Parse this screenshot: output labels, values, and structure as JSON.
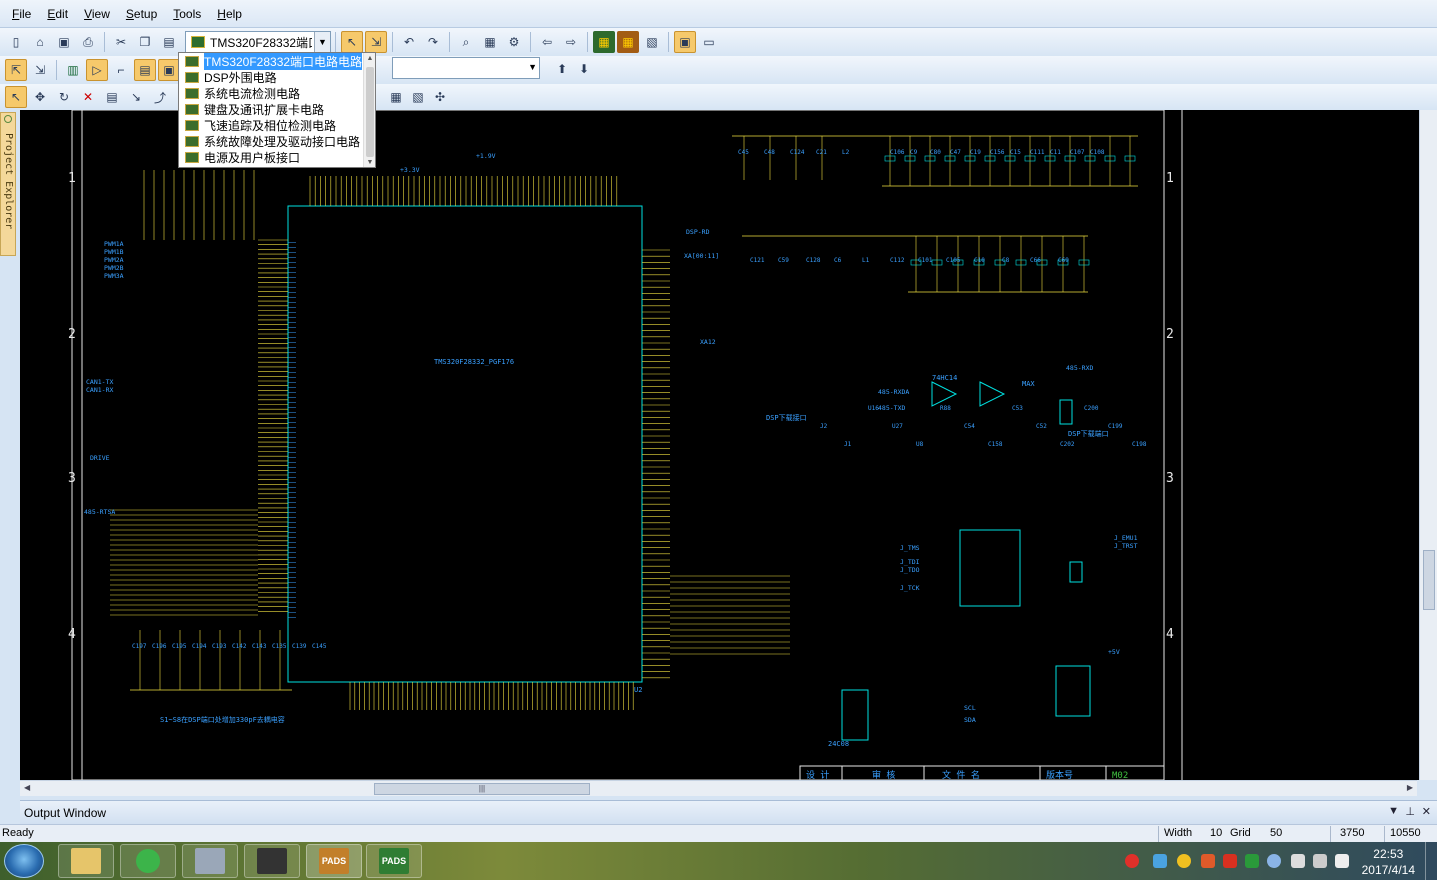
{
  "menu": [
    {
      "label": "File",
      "u": "F",
      "rest": "ile"
    },
    {
      "label": "Edit",
      "u": "E",
      "rest": "dit"
    },
    {
      "label": "View",
      "u": "V",
      "rest": "iew"
    },
    {
      "label": "Setup",
      "u": "S",
      "rest": "etup"
    },
    {
      "label": "Tools",
      "u": "T",
      "rest": "ools"
    },
    {
      "label": "Help",
      "u": "H",
      "rest": "elp"
    }
  ],
  "sheet_combo": {
    "value": "TMS320F28332端口电路电路"
  },
  "sheet_list": [
    {
      "label": "TMS320F28332端口电路电路",
      "selected": true
    },
    {
      "label": "DSP外围电路",
      "selected": false
    },
    {
      "label": "系统电流检测电路",
      "selected": false
    },
    {
      "label": "键盘及通讯扩展卡电路",
      "selected": false
    },
    {
      "label": "飞速追踪及相位检测电路",
      "selected": false
    },
    {
      "label": "系统故障处理及驱动接口电路",
      "selected": false
    },
    {
      "label": "电源及用户板接口",
      "selected": false
    }
  ],
  "project_explorer": {
    "label": "Project Explorer"
  },
  "output_window": {
    "title": "Output Window"
  },
  "status": {
    "ready": "Ready",
    "width_label": "Width",
    "width_value": "10",
    "grid_label": "Grid",
    "grid_value": "50",
    "x": "3750",
    "y": "10550"
  },
  "taskbar": {
    "pads1": "PADS",
    "pads2": "PADS",
    "time": "22:53",
    "date": "2017/4/14"
  },
  "schematic": {
    "border_rows_left": [
      "1",
      "2",
      "3",
      "4"
    ],
    "border_rows_right": [
      "1",
      "2",
      "3",
      "4"
    ],
    "chip_label": "TMS320F28332_PGF176",
    "chip_ref": "U2",
    "net_labels": [
      "DSP-RD",
      "XA[00:11]",
      "XA12",
      "PWM1A",
      "PWM1B",
      "PWM2A",
      "PWM2B",
      "PWM3A",
      "DRIVE",
      "485-RTSA",
      "CAN1-TX",
      "CAN1-RX",
      "485-RXD",
      "485-TXD",
      "485-RXDA",
      "SCL",
      "SDA",
      "J_EMU1",
      "J_TRST",
      "J_TMS",
      "J_TDI",
      "J_TDO",
      "J_TCK",
      "+3.3V",
      "+1.9V",
      "+5V"
    ],
    "component_labels": [
      "C45",
      "C48",
      "C124",
      "C21",
      "L2",
      "C106",
      "C9",
      "C80",
      "C47",
      "C19",
      "C156",
      "C15",
      "C111",
      "C11",
      "C107",
      "C108",
      "C121",
      "C59",
      "C128",
      "C6",
      "L1",
      "C112",
      "C101",
      "C105",
      "C10",
      "C8",
      "C66",
      "C69",
      "J2",
      "J1",
      "U16",
      "U27",
      "U8",
      "R88",
      "C54",
      "C158",
      "C53",
      "C52",
      "C202",
      "C200",
      "C199",
      "C198",
      "C197",
      "C196",
      "C195",
      "C194",
      "C193",
      "C142",
      "C143",
      "C135",
      "C139",
      "C145"
    ],
    "note": "S1~S8在DSP端口处增加330pF去耦电容",
    "block_labels": [
      "DSP下载接口",
      "DSP下载端口",
      "24C08",
      "74HC14",
      "MAX"
    ],
    "title_block": [
      "设 计",
      "审 核",
      "文 件 名",
      "版本号",
      "M02"
    ]
  }
}
